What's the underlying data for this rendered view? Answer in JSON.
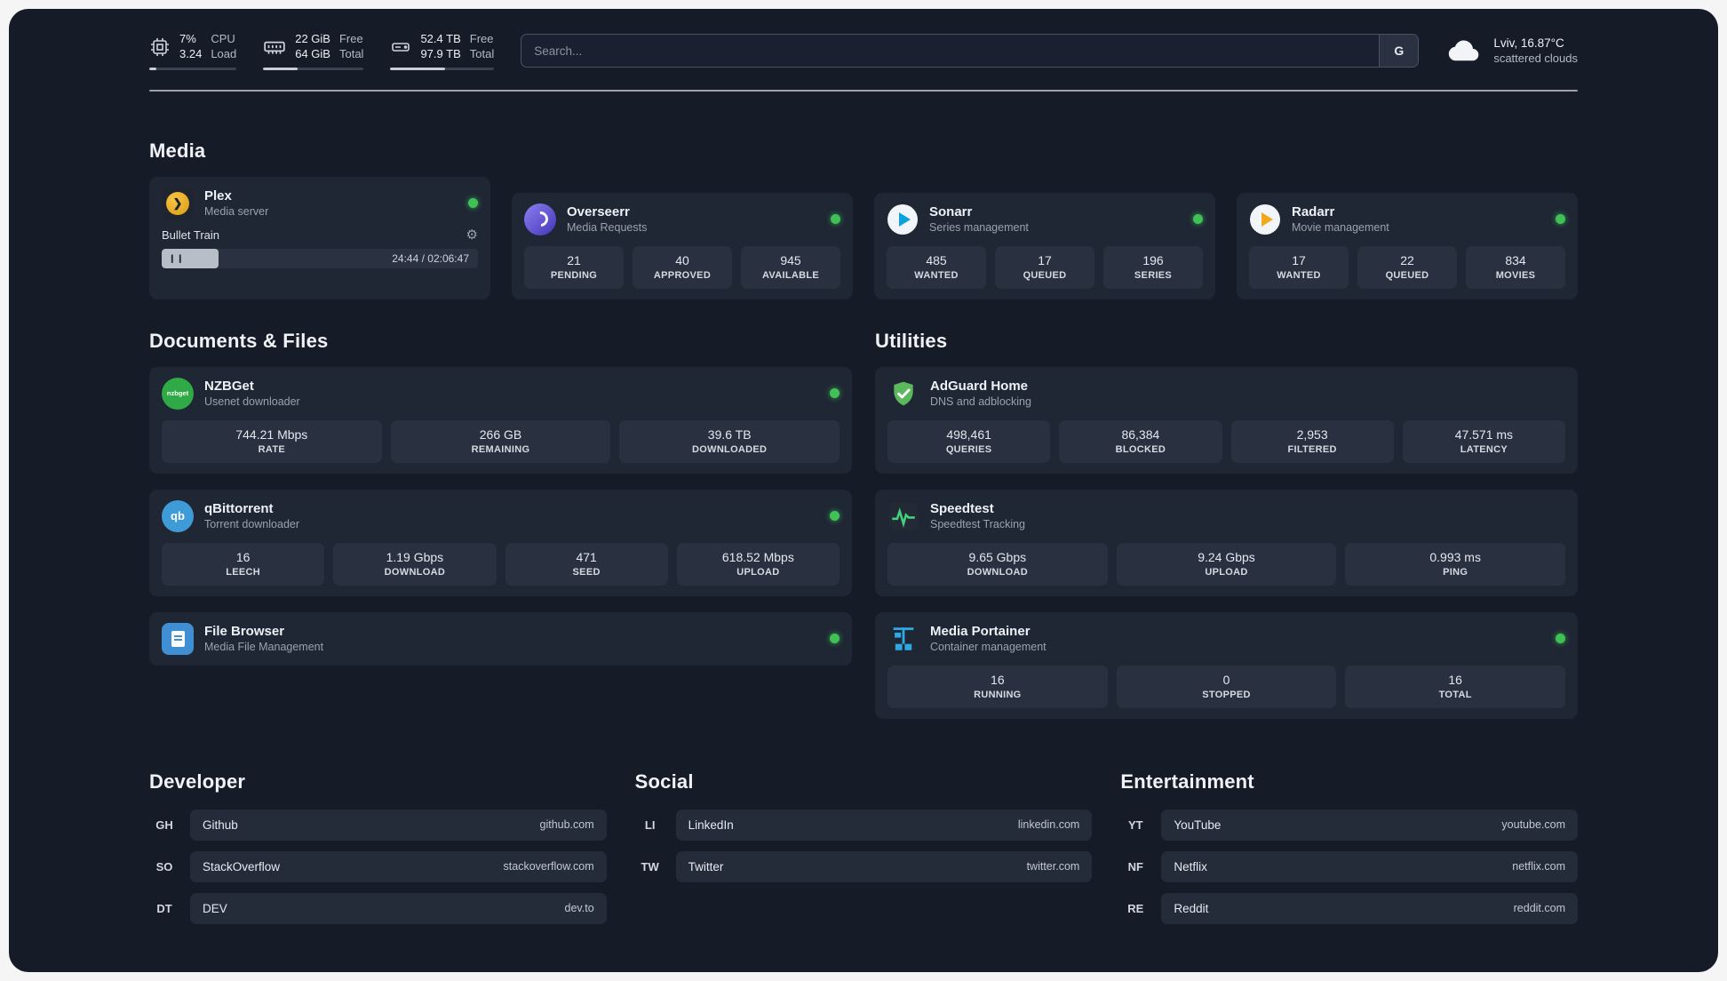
{
  "colors": {
    "background": "#161b28",
    "card": "#1f2634",
    "stat_box": "#29303f",
    "status_online": "#3fc155",
    "plex_amber": "#dd9c12",
    "adguard_green": "#5cb85c",
    "portainer_blue": "#2fa8e1"
  },
  "topbar": {
    "stats": [
      {
        "icon": "cpu-icon",
        "value": "7%",
        "value2": "3.24",
        "label": "CPU",
        "label2": "Load",
        "progress": 8
      },
      {
        "icon": "ram-icon",
        "value": "22 GiB",
        "value2": "64 GiB",
        "label": "Free",
        "label2": "Total",
        "progress": 34
      },
      {
        "icon": "disk-icon",
        "value": "52.4 TB",
        "value2": "97.9 TB",
        "label": "Free",
        "label2": "Total",
        "progress": 53
      }
    ],
    "search": {
      "placeholder": "Search...",
      "engine_button": "G"
    },
    "weather": {
      "icon": "cloud-icon",
      "location": "Lviv, 16.87°C",
      "condition": "scattered clouds"
    }
  },
  "sections": {
    "media": {
      "title": "Media",
      "apps": [
        {
          "name": "Plex",
          "desc": "Media server",
          "icon": "plex-icon",
          "icon_glyph": "❯",
          "online": true,
          "player": {
            "track": "Bullet Train",
            "time": "24:44 / 02:06:47",
            "progress": 18,
            "pause_glyph": "❙❙",
            "settings_glyph": "⚙"
          }
        },
        {
          "name": "Overseerr",
          "desc": "Media Requests",
          "icon": "overseerr-icon",
          "online": true,
          "stats": [
            {
              "value": "21",
              "label": "PENDING"
            },
            {
              "value": "40",
              "label": "APPROVED"
            },
            {
              "value": "945",
              "label": "AVAILABLE"
            }
          ]
        },
        {
          "name": "Sonarr",
          "desc": "Series management",
          "icon": "sonarr-icon",
          "online": true,
          "stats": [
            {
              "value": "485",
              "label": "WANTED"
            },
            {
              "value": "17",
              "label": "QUEUED"
            },
            {
              "value": "196",
              "label": "SERIES"
            }
          ]
        },
        {
          "name": "Radarr",
          "desc": "Movie management",
          "icon": "radarr-icon",
          "online": true,
          "stats": [
            {
              "value": "17",
              "label": "WANTED"
            },
            {
              "value": "22",
              "label": "QUEUED"
            },
            {
              "value": "834",
              "label": "MOVIES"
            }
          ]
        }
      ]
    },
    "documents": {
      "title": "Documents & Files",
      "apps": [
        {
          "name": "NZBGet",
          "desc": "Usenet downloader",
          "icon": "nzbget-icon",
          "icon_text": "nzbget",
          "online": true,
          "stats": [
            {
              "value": "744.21 Mbps",
              "label": "RATE"
            },
            {
              "value": "266 GB",
              "label": "REMAINING"
            },
            {
              "value": "39.6 TB",
              "label": "DOWNLOADED"
            }
          ]
        },
        {
          "name": "qBittorrent",
          "desc": "Torrent downloader",
          "icon": "qbittorrent-icon",
          "icon_text": "qb",
          "online": true,
          "stats": [
            {
              "value": "16",
              "label": "LEECH"
            },
            {
              "value": "1.19 Gbps",
              "label": "DOWNLOAD"
            },
            {
              "value": "471",
              "label": "SEED"
            },
            {
              "value": "618.52 Mbps",
              "label": "UPLOAD"
            }
          ]
        },
        {
          "name": "File Browser",
          "desc": "Media File Management",
          "icon": "filebrowser-icon",
          "online": true
        }
      ]
    },
    "utilities": {
      "title": "Utilities",
      "apps": [
        {
          "name": "AdGuard Home",
          "desc": "DNS and adblocking",
          "icon": "adguard-icon",
          "stats": [
            {
              "value": "498,461",
              "label": "QUERIES"
            },
            {
              "value": "86,384",
              "label": "BLOCKED"
            },
            {
              "value": "2,953",
              "label": "FILTERED"
            },
            {
              "value": "47.571 ms",
              "label": "LATENCY"
            }
          ]
        },
        {
          "name": "Speedtest",
          "desc": "Speedtest Tracking",
          "icon": "speedtest-icon",
          "stats": [
            {
              "value": "9.65 Gbps",
              "label": "DOWNLOAD"
            },
            {
              "value": "9.24 Gbps",
              "label": "UPLOAD"
            },
            {
              "value": "0.993 ms",
              "label": "PING"
            }
          ]
        },
        {
          "name": "Media Portainer",
          "desc": "Container management",
          "icon": "portainer-icon",
          "online": true,
          "stats": [
            {
              "value": "16",
              "label": "RUNNING"
            },
            {
              "value": "0",
              "label": "STOPPED"
            },
            {
              "value": "16",
              "label": "TOTAL"
            }
          ]
        }
      ]
    }
  },
  "bookmarks": {
    "developer": {
      "title": "Developer",
      "items": [
        {
          "abbr": "GH",
          "name": "Github",
          "url": "github.com"
        },
        {
          "abbr": "SO",
          "name": "StackOverflow",
          "url": "stackoverflow.com"
        },
        {
          "abbr": "DT",
          "name": "DEV",
          "url": "dev.to"
        }
      ]
    },
    "social": {
      "title": "Social",
      "items": [
        {
          "abbr": "LI",
          "name": "LinkedIn",
          "url": "linkedin.com"
        },
        {
          "abbr": "TW",
          "name": "Twitter",
          "url": "twitter.com"
        }
      ]
    },
    "entertainment": {
      "title": "Entertainment",
      "items": [
        {
          "abbr": "YT",
          "name": "YouTube",
          "url": "youtube.com"
        },
        {
          "abbr": "NF",
          "name": "Netflix",
          "url": "netflix.com"
        },
        {
          "abbr": "RE",
          "name": "Reddit",
          "url": "reddit.com"
        }
      ]
    }
  }
}
